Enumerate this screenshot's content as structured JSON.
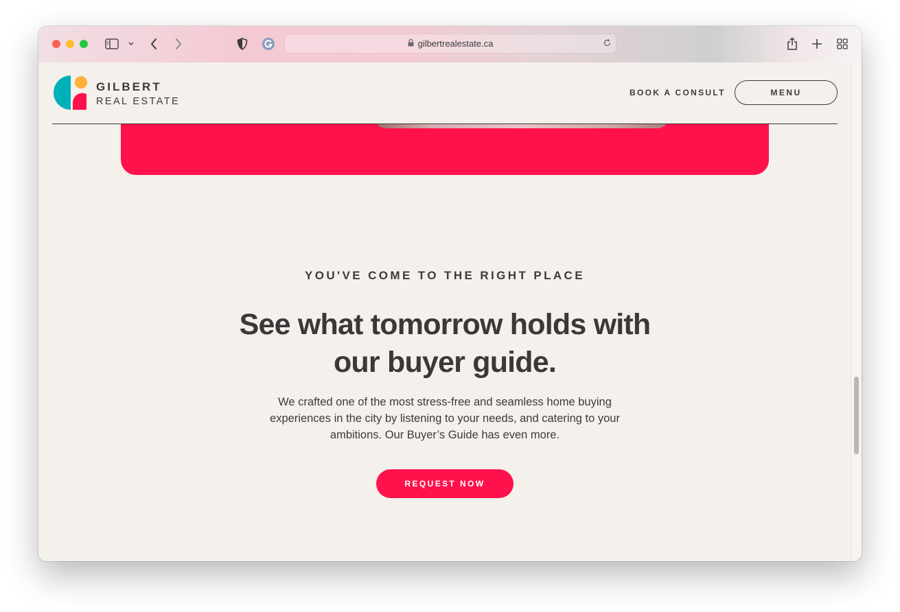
{
  "browser": {
    "url": "gilbertrealestate.ca"
  },
  "site": {
    "brand_name": "GILBERT",
    "brand_sub": "REAL ESTATE",
    "nav": {
      "consult_label": "BOOK A CONSULT",
      "menu_label": "MENU"
    }
  },
  "section": {
    "eyebrow": "YOU'VE COME TO THE RIGHT PLACE",
    "headline": "See what tomorrow holds with our buyer guide.",
    "body": "We crafted one of the most stress-free and seamless home buying experiences in the city by listening to your needs, and catering to your ambitions. Our Buyer’s Guide has even more.",
    "cta_label": "REQUEST NOW"
  },
  "colors": {
    "brand_red": "#ff124b",
    "brand_teal": "#00b0b9",
    "brand_orange": "#ffae39",
    "page_bg": "#f4f0ec",
    "text_dark": "#3d3a3a"
  }
}
